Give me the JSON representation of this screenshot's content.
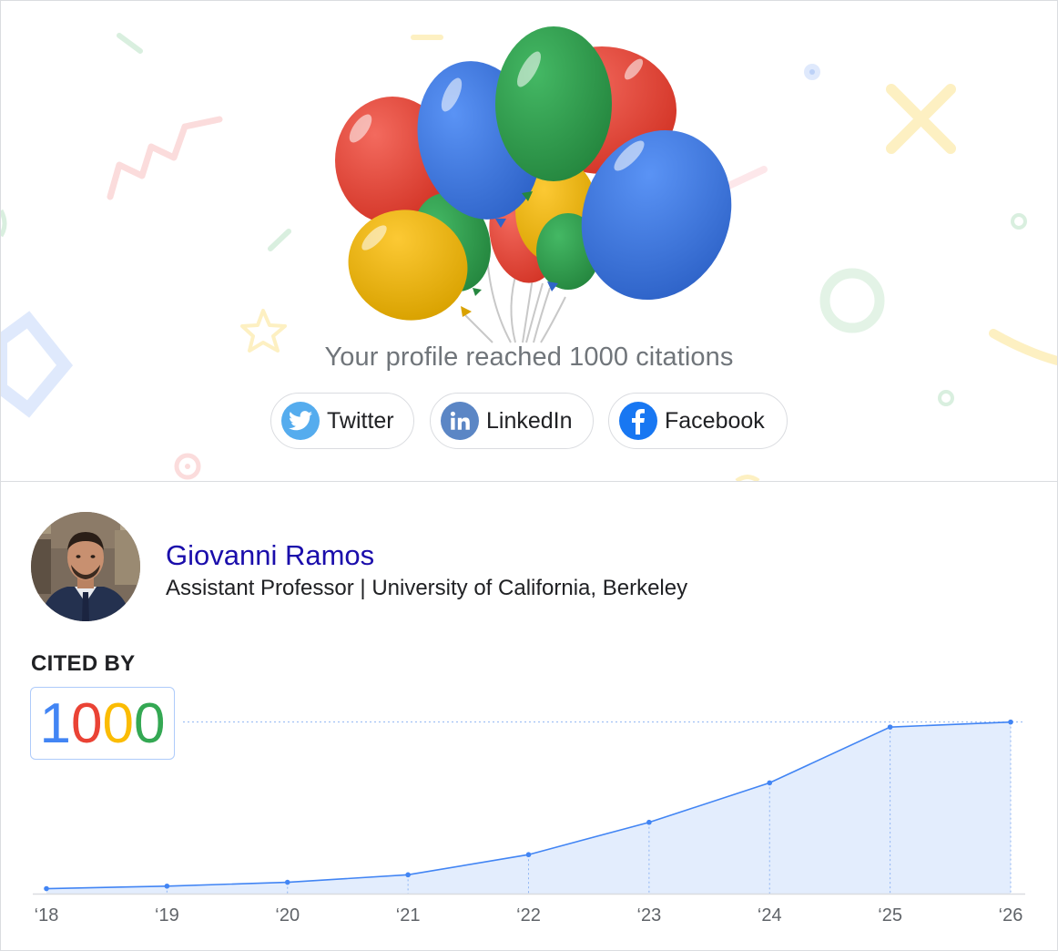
{
  "milestone": {
    "text": "Your profile reached 1000 citations"
  },
  "share": {
    "twitter": {
      "label": "Twitter",
      "icon": "twitter-icon",
      "color": "#55acee"
    },
    "linkedin": {
      "label": "LinkedIn",
      "icon": "linkedin-icon",
      "color": "#5b86c5"
    },
    "facebook": {
      "label": "Facebook",
      "icon": "facebook-icon",
      "color": "#1877f2"
    }
  },
  "profile": {
    "name": "Giovanni Ramos",
    "affiliation": "Assistant Professor | University of California, Berkeley"
  },
  "cited_by": {
    "label": "CITED BY",
    "count_digits": [
      "1",
      "0",
      "0",
      "0"
    ],
    "digit_colors": [
      "#4285f4",
      "#ea4335",
      "#fbbc04",
      "#34a853"
    ]
  },
  "chart_data": {
    "type": "area",
    "categories": [
      "‘18",
      "‘19",
      "‘20",
      "‘21",
      "‘22",
      "‘23",
      "‘24",
      "‘25",
      "‘26"
    ],
    "values": [
      30,
      45,
      68,
      113,
      234,
      428,
      665,
      1000,
      1030
    ],
    "ylim": [
      0,
      1050
    ],
    "grid": false,
    "line_color": "#4285f4",
    "fill_color": "#e3edfd"
  }
}
